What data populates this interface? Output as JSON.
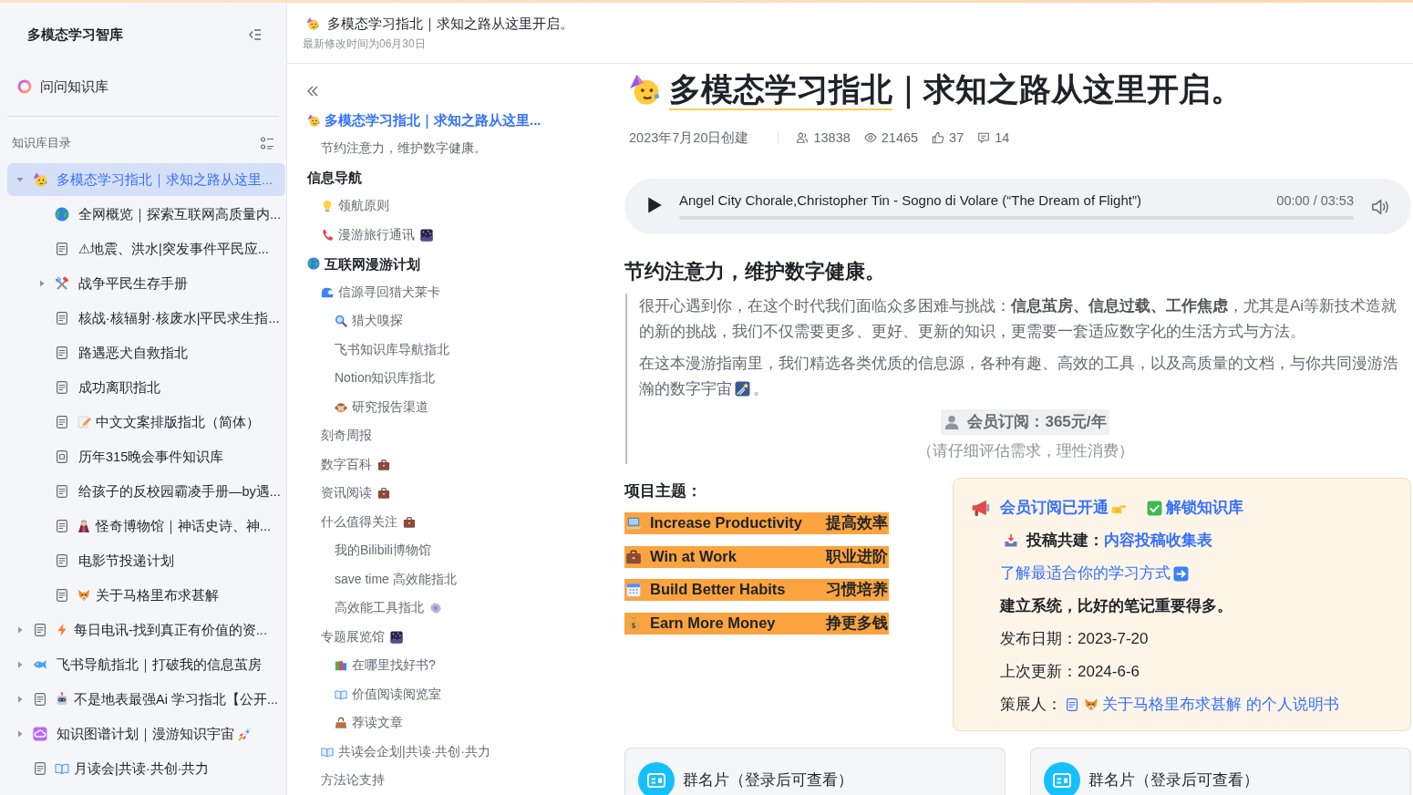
{
  "sidebar": {
    "title": "多模态学习智库",
    "ask_label": "问问知识库",
    "section_label": "知识库目录",
    "tree": [
      {
        "label": "多模态学习指北｜求知之路从这里...",
        "selected": true,
        "expanded": true,
        "children": [
          {
            "label": "全网概览｜探索互联网高质量内...",
            "selected": false
          },
          {
            "label": "⚠地震、洪水|突发事件平民应...",
            "selected": false
          },
          {
            "label": "战争平民生存手册",
            "selected": false,
            "expanded": false
          },
          {
            "label": "核战·核辐射·核废水|平民求生指...",
            "selected": false
          },
          {
            "label": "路遇恶犬自救指北",
            "selected": false
          },
          {
            "label": "成功离职指北",
            "selected": false
          },
          {
            "label": "中文文案排版指北（简体）",
            "selected": false
          },
          {
            "label": "历年315晚会事件知识库",
            "selected": false
          },
          {
            "label": "给孩子的反校园霸凌手册—by遇...",
            "selected": false
          },
          {
            "label": "怪奇博物馆｜神话史诗、神...",
            "selected": false
          },
          {
            "label": "电影节投递计划",
            "selected": false
          },
          {
            "label": "关于马格里布求甚解",
            "selected": false
          }
        ]
      },
      {
        "label": "每日电讯-找到真正有价值的资...",
        "selected": false,
        "expanded": false
      },
      {
        "label": "飞书导航指北｜打破我的信息茧房",
        "selected": false,
        "expanded": false
      },
      {
        "label": "不是地表最强Ai 学习指北【公开...",
        "selected": false,
        "expanded": false
      },
      {
        "label": "知识图谱计划｜漫游知识宇宙",
        "selected": false,
        "expanded": false
      },
      {
        "label": "月读会|共读·共创·共力",
        "selected": false
      }
    ]
  },
  "doc_header": {
    "title": "多模态学习指北｜求知之路从这里开启。",
    "modified": "最新修改时间为06月30日"
  },
  "outline": [
    {
      "label": "多模态学习指北｜求知之路从这里...",
      "selected": true,
      "children": [
        {
          "label": "节约注意力，维护数字健康。",
          "selected": false
        }
      ]
    },
    {
      "label": "信息导航",
      "selected": false,
      "children": [
        {
          "label": "领航原则",
          "selected": false
        },
        {
          "label": "漫游旅行通讯",
          "selected": false
        }
      ]
    },
    {
      "label": "互联网漫游计划",
      "selected": false,
      "children": [
        {
          "label": "信源寻回猎犬莱卡",
          "selected": false,
          "children": [
            {
              "label": "猎犬嗅探",
              "selected": false
            },
            {
              "label": "飞书知识库导航指北",
              "selected": false
            },
            {
              "label": "Notion知识库指北",
              "selected": false
            },
            {
              "label": "研究报告渠道",
              "selected": false
            }
          ]
        },
        {
          "label": "刻奇周报",
          "selected": false
        },
        {
          "label": "数字百科",
          "selected": false
        },
        {
          "label": "资讯阅读",
          "selected": false
        },
        {
          "label": "什么值得关注",
          "selected": false,
          "children": [
            {
              "label": "我的Bilibili博物馆",
              "selected": false
            },
            {
              "label": "save time 高效能指北",
              "selected": false
            },
            {
              "label": "高效能工具指北",
              "selected": false
            }
          ]
        },
        {
          "label": "专题展览馆",
          "selected": false,
          "children": [
            {
              "label": "在哪里找好书?",
              "selected": false
            },
            {
              "label": "价值阅读阅览室",
              "selected": false
            },
            {
              "label": "荐读文章",
              "selected": false
            }
          ]
        },
        {
          "label": "共读会企划|共读·共创·共力",
          "selected": false
        },
        {
          "label": "方法论支持",
          "selected": false
        }
      ]
    }
  ],
  "article": {
    "title_marked": "多模态学习指北",
    "title_rest": "｜求知之路从这里开启。",
    "created": "2023年7月20日创建",
    "stats": [
      {
        "kind": "visitors",
        "value": "13838"
      },
      {
        "kind": "views",
        "value": "21465"
      },
      {
        "kind": "likes",
        "value": "37"
      },
      {
        "kind": "comments",
        "value": "14"
      }
    ],
    "player": {
      "track": "Angel City Chorale,Christopher Tin - Sogno di Volare (“The Dream of Flight”)",
      "time": "00:00 / 03:53",
      "playing": false
    },
    "heading": "节约注意力，维护数字健康。",
    "quote": [
      {
        "text": "很开心遇到你，在这个时代我们面临众多困难与挑战：**信息茧房、信息过载、工作焦虑**，尤其是Ai等新技术造就的新的挑战，我们不仅需要更多、更好、更新的知识，更需要一套适应数字化的生活方式与方法。"
      },
      {
        "text": "在这本漫游指南里，我们精选各类优质的信息源，各种有趣、高效的工具，以及高质量的文档，与你共同漫游浩瀚的数字宇宙",
        "text_after": "。"
      }
    ],
    "membership": {
      "price": "会员订阅：365元/年",
      "note": "（请仔细评估需求，理性消费）"
    },
    "topics_label": "项目主题：",
    "topics": [
      {
        "english": "Increase Productivity",
        "chinese": "提高效率"
      },
      {
        "english": "Win at Work",
        "chinese": "职业进阶"
      },
      {
        "english": "Build Better Habits",
        "chinese": "习惯培养"
      },
      {
        "english": "Earn More Money",
        "chinese": "挣更多钱"
      }
    ],
    "callout": {
      "status_links": [
        "会员订阅已开通",
        "解锁知识库"
      ],
      "submit_label": "投稿共建：",
      "submit_link": "内容投稿收集表",
      "learn_link": "了解最适合你的学习方式",
      "motto": "建立系统，比好的笔记重要得多。",
      "details": [
        "发布日期：2023-7-20",
        "上次更新：2024-6-6"
      ],
      "curator_label": "策展人：",
      "curator_link": "关于马格里布求甚解 的个人说明书"
    },
    "cards": [
      "群名片（登录后可查看）",
      "群名片（登录后可查看）"
    ]
  }
}
